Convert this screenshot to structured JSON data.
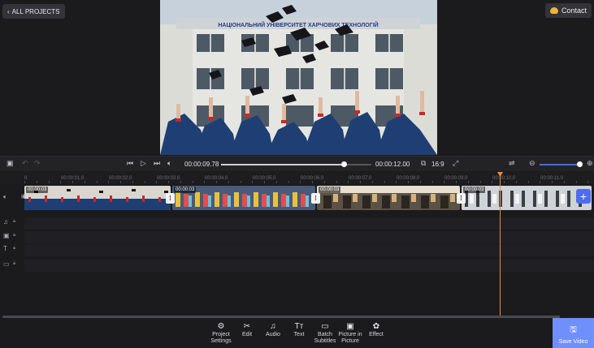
{
  "header": {
    "back_label": "ALL PROJECTS",
    "contact_label": "Contact"
  },
  "preview": {
    "banner_text": "НАЦІОНАЛЬНИЙ УНІВЕРСИТЕТ ХАРЧОВИХ ТЕХНОЛОГІЙ"
  },
  "player": {
    "current_time": "00:00:09.78",
    "total_time": "00:00:12.00",
    "aspect_ratio": "16:9",
    "progress_fraction": 0.815,
    "zoom_fraction": 1.0
  },
  "ruler": {
    "labels": [
      "0",
      "00:00:01.0",
      "00:00:02.0",
      "00:00:03.0",
      "00:00:04.0",
      "00:00:05.0",
      "00:00:06.0",
      "00:00:07.0",
      "00:00:08.0",
      "00:00:09.0",
      "00:00:10.0",
      "00:00:11.0"
    ]
  },
  "timeline": {
    "clips": [
      {
        "duration": "00:00:03"
      },
      {
        "duration": "00:00:03"
      },
      {
        "duration": "00:00:03"
      },
      {
        "duration": "00:00:03"
      }
    ],
    "add_label": "+"
  },
  "toolbar": {
    "items": [
      {
        "label": "Project Settings",
        "icon": "gear-icon"
      },
      {
        "label": "Edit",
        "icon": "scissors-icon"
      },
      {
        "label": "Audio",
        "icon": "music-note-icon"
      },
      {
        "label": "Text",
        "icon": "text-icon"
      },
      {
        "label": "Batch Subtitles",
        "icon": "subtitles-icon"
      },
      {
        "label": "Picture in Picture",
        "icon": "pip-icon"
      },
      {
        "label": "Effect",
        "icon": "effect-icon"
      }
    ],
    "save_label": "Save Video"
  },
  "colors": {
    "accent": "#4f6bf2",
    "save": "#6f8ffa",
    "playhead": "#f08a3c"
  }
}
